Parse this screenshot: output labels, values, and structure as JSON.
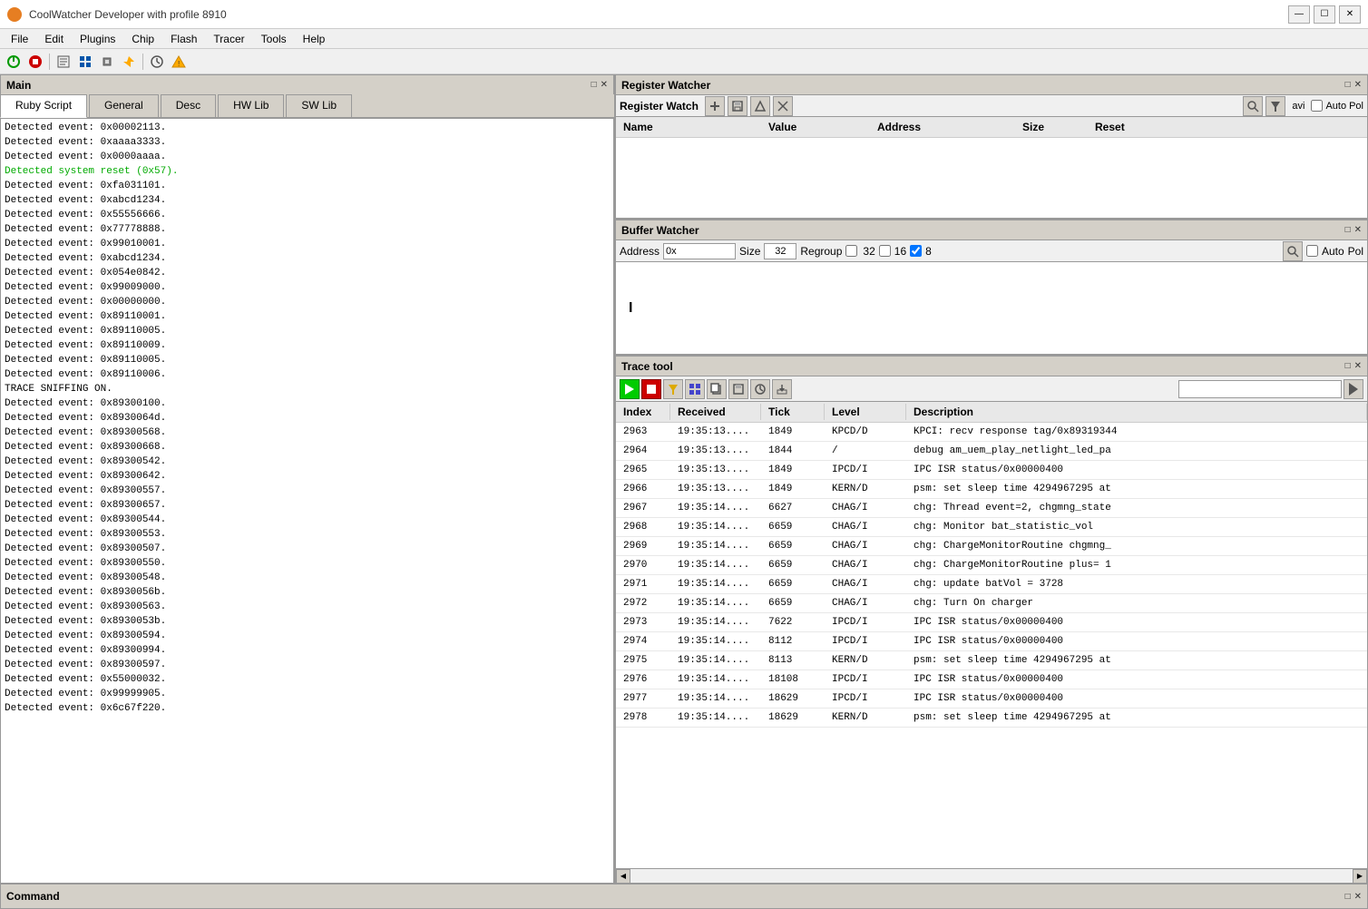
{
  "window": {
    "title": "CoolWatcher Developer with profile 8910",
    "icon": "🔧"
  },
  "menu": {
    "items": [
      "File",
      "Edit",
      "Plugins",
      "Chip",
      "Flash",
      "Tracer",
      "Tools",
      "Help"
    ]
  },
  "main_panel": {
    "title": "Main",
    "tabs": [
      "Ruby Script",
      "General",
      "Desc",
      "HW Lib",
      "SW Lib"
    ],
    "active_tab": "Ruby Script",
    "log_lines": [
      {
        "text": "Detected event: 0x00002113.",
        "class": ""
      },
      {
        "text": "Detected event: 0xaaaa3333.",
        "class": ""
      },
      {
        "text": "Detected event: 0x0000aaaa.",
        "class": ""
      },
      {
        "text": "Detected system reset (0x57).",
        "class": "highlight"
      },
      {
        "text": "Detected event: 0xfa031101.",
        "class": ""
      },
      {
        "text": "Detected event: 0xabcd1234.",
        "class": ""
      },
      {
        "text": "Detected event: 0x55556666.",
        "class": ""
      },
      {
        "text": "Detected event: 0x77778888.",
        "class": ""
      },
      {
        "text": "Detected event: 0x99010001.",
        "class": ""
      },
      {
        "text": "Detected event: 0xabcd1234.",
        "class": ""
      },
      {
        "text": "Detected event: 0x054e0842.",
        "class": ""
      },
      {
        "text": "Detected event: 0x99009000.",
        "class": ""
      },
      {
        "text": "Detected event: 0x00000000.",
        "class": ""
      },
      {
        "text": "Detected event: 0x89110001.",
        "class": ""
      },
      {
        "text": "Detected event: 0x89110005.",
        "class": ""
      },
      {
        "text": "Detected event: 0x89110009.",
        "class": ""
      },
      {
        "text": "Detected event: 0x89110005.",
        "class": ""
      },
      {
        "text": "Detected event: 0x89110006.",
        "class": ""
      },
      {
        "text": "TRACE SNIFFING ON.",
        "class": ""
      },
      {
        "text": "Detected event: 0x89300100.",
        "class": ""
      },
      {
        "text": "Detected event: 0x8930064d.",
        "class": ""
      },
      {
        "text": "Detected event: 0x89300568.",
        "class": ""
      },
      {
        "text": "Detected event: 0x89300668.",
        "class": ""
      },
      {
        "text": "Detected event: 0x89300542.",
        "class": ""
      },
      {
        "text": "Detected event: 0x89300642.",
        "class": ""
      },
      {
        "text": "Detected event: 0x89300557.",
        "class": ""
      },
      {
        "text": "Detected event: 0x89300657.",
        "class": ""
      },
      {
        "text": "Detected event: 0x89300544.",
        "class": ""
      },
      {
        "text": "Detected event: 0x89300553.",
        "class": ""
      },
      {
        "text": "Detected event: 0x89300507.",
        "class": ""
      },
      {
        "text": "Detected event: 0x89300550.",
        "class": ""
      },
      {
        "text": "Detected event: 0x89300548.",
        "class": ""
      },
      {
        "text": "Detected event: 0x8930056b.",
        "class": ""
      },
      {
        "text": "Detected event: 0x89300563.",
        "class": ""
      },
      {
        "text": "Detected event: 0x8930053b.",
        "class": ""
      },
      {
        "text": "Detected event: 0x89300594.",
        "class": ""
      },
      {
        "text": "Detected event: 0x89300994.",
        "class": ""
      },
      {
        "text": "Detected event: 0x89300597.",
        "class": ""
      },
      {
        "text": "Detected event: 0x55000032.",
        "class": ""
      },
      {
        "text": "Detected event: 0x99999905.",
        "class": ""
      },
      {
        "text": "Detected event: 0x6c67f220.",
        "class": ""
      }
    ]
  },
  "register_watcher": {
    "title": "Register Watcher",
    "subtool_title": "Register Watch",
    "columns": [
      "Name",
      "Value",
      "Address",
      "Size",
      "Reset"
    ],
    "auto_label": "Auto",
    "pol_label": "Pol"
  },
  "buffer_watcher": {
    "title": "Buffer Watcher",
    "address_label": "Address",
    "address_value": "0x",
    "size_label": "Size",
    "size_value": "32",
    "regroup_label": "Regroup",
    "val32": "32",
    "val16": "16",
    "val8": "8",
    "auto_label": "Auto",
    "pol_label": "Pol"
  },
  "trace_tool": {
    "title": "Trace tool",
    "columns": [
      "Index",
      "Received",
      "Tick",
      "Level",
      "Description"
    ],
    "rows": [
      {
        "index": "2963",
        "received": "19:35:13....",
        "tick": "1849",
        "level": "KPCD/D",
        "desc": "KPCI: recv response tag/0x89319344"
      },
      {
        "index": "2964",
        "received": "19:35:13....",
        "tick": "1844",
        "level": "/",
        "desc": "debug am_uem_play_netlight_led_pa"
      },
      {
        "index": "2965",
        "received": "19:35:13....",
        "tick": "1849",
        "level": "IPCD/I",
        "desc": "IPC ISR status/0x00000400"
      },
      {
        "index": "2966",
        "received": "19:35:13....",
        "tick": "1849",
        "level": "KERN/D",
        "desc": "psm: set sleep time 4294967295 at"
      },
      {
        "index": "2967",
        "received": "19:35:14....",
        "tick": "6627",
        "level": "CHAG/I",
        "desc": "chg: Thread event=2, chgmng_state"
      },
      {
        "index": "2968",
        "received": "19:35:14....",
        "tick": "6659",
        "level": "CHAG/I",
        "desc": "chg:  Monitor  bat_statistic_vol"
      },
      {
        "index": "2969",
        "received": "19:35:14....",
        "tick": "6659",
        "level": "CHAG/I",
        "desc": "chg: ChargeMonitorRoutine chgmng_"
      },
      {
        "index": "2970",
        "received": "19:35:14....",
        "tick": "6659",
        "level": "CHAG/I",
        "desc": "chg: ChargeMonitorRoutine plus= 1"
      },
      {
        "index": "2971",
        "received": "19:35:14....",
        "tick": "6659",
        "level": "CHAG/I",
        "desc": "chg: update batVol = 3728"
      },
      {
        "index": "2972",
        "received": "19:35:14....",
        "tick": "6659",
        "level": "CHAG/I",
        "desc": "chg: Turn On charger"
      },
      {
        "index": "2973",
        "received": "19:35:14....",
        "tick": "7622",
        "level": "IPCD/I",
        "desc": "IPC ISR status/0x00000400"
      },
      {
        "index": "2974",
        "received": "19:35:14....",
        "tick": "8112",
        "level": "IPCD/I",
        "desc": "IPC ISR status/0x00000400"
      },
      {
        "index": "2975",
        "received": "19:35:14....",
        "tick": "8113",
        "level": "KERN/D",
        "desc": "psm: set sleep time 4294967295 at"
      },
      {
        "index": "2976",
        "received": "19:35:14....",
        "tick": "18108",
        "level": "IPCD/I",
        "desc": "IPC ISR status/0x00000400"
      },
      {
        "index": "2977",
        "received": "19:35:14....",
        "tick": "18629",
        "level": "IPCD/I",
        "desc": "IPC ISR status/0x00000400"
      },
      {
        "index": "2978",
        "received": "19:35:14....",
        "tick": "18629",
        "level": "KERN/D",
        "desc": "psm: set sleep time 4294967295 at"
      }
    ]
  },
  "command_bar": {
    "title": "Command"
  }
}
